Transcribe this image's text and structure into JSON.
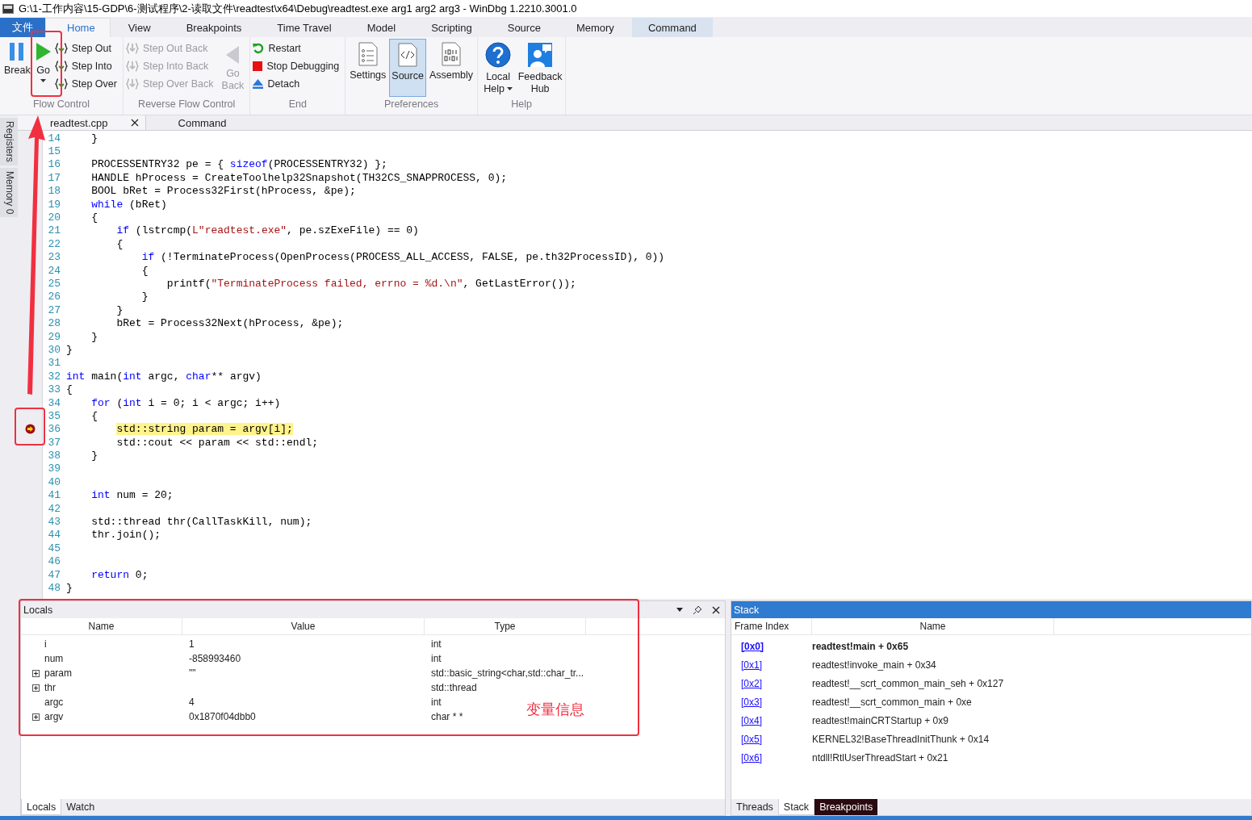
{
  "window": {
    "title": "G:\\1-工作内容\\15-GDP\\6-测试程序\\2-读取文件\\readtest\\x64\\Debug\\readtest.exe arg1 arg2 arg3 - WinDbg 1.2210.3001.0"
  },
  "file_tab": "文件",
  "ribbon_tabs": [
    {
      "label": "Home",
      "selected": true,
      "hovered": false
    },
    {
      "label": "View",
      "selected": false,
      "hovered": false
    },
    {
      "label": "Breakpoints",
      "selected": false,
      "hovered": false
    },
    {
      "label": "Time Travel",
      "selected": false,
      "hovered": false
    },
    {
      "label": "Model",
      "selected": false,
      "hovered": false
    },
    {
      "label": "Scripting",
      "selected": false,
      "hovered": false
    },
    {
      "label": "Source",
      "selected": false,
      "hovered": false
    },
    {
      "label": "Memory",
      "selected": false,
      "hovered": false
    },
    {
      "label": "Command",
      "selected": false,
      "hovered": true
    }
  ],
  "ribbon_groups": [
    {
      "label": "Flow Control",
      "items": [
        {
          "kind": "large",
          "label": "Break",
          "disabled": false,
          "selected": false,
          "dropdown": false
        },
        {
          "kind": "large",
          "label": "Go",
          "disabled": false,
          "selected": false,
          "dropdown": true
        },
        {
          "kind": "column",
          "buttons": [
            {
              "label": "Step Out",
              "disabled": false
            },
            {
              "label": "Step Into",
              "disabled": false
            },
            {
              "label": "Step Over",
              "disabled": false
            }
          ]
        }
      ]
    },
    {
      "label": "Reverse Flow Control",
      "items": [
        {
          "kind": "column",
          "buttons": [
            {
              "label": "Step Out Back",
              "disabled": true
            },
            {
              "label": "Step Into Back",
              "disabled": true
            },
            {
              "label": "Step Over Back",
              "disabled": true
            }
          ]
        },
        {
          "kind": "large",
          "label": "Go Back",
          "disabled": true,
          "selected": false,
          "dropdown": false
        }
      ]
    },
    {
      "label": "End",
      "items": [
        {
          "kind": "column",
          "buttons": [
            {
              "label": "Restart",
              "disabled": false
            },
            {
              "label": "Stop Debugging",
              "disabled": false
            },
            {
              "label": "Detach",
              "disabled": false
            }
          ]
        }
      ]
    },
    {
      "label": "Preferences",
      "items": [
        {
          "kind": "large",
          "label": "Settings",
          "disabled": false,
          "selected": false,
          "dropdown": false
        },
        {
          "kind": "large",
          "label": "Source",
          "disabled": false,
          "selected": true,
          "dropdown": false
        },
        {
          "kind": "large",
          "label": "Assembly",
          "disabled": false,
          "selected": false,
          "dropdown": false
        }
      ]
    },
    {
      "label": "Help",
      "items": [
        {
          "kind": "large",
          "label": "Local Help",
          "disabled": false,
          "selected": false,
          "dropdown": true
        },
        {
          "kind": "large",
          "label": "Feedback Hub",
          "disabled": false,
          "selected": false,
          "dropdown": false
        }
      ]
    }
  ],
  "side_tabs": [
    "Registers",
    "Memory 0"
  ],
  "doc_tabs": [
    {
      "label": "readtest.cpp",
      "selected": true,
      "closable": true
    },
    {
      "label": "Command",
      "selected": false,
      "closable": false
    }
  ],
  "code": [
    {
      "num": "14",
      "current": false,
      "segs": [
        {
          "kind": "plain",
          "t": "    }"
        }
      ]
    },
    {
      "num": "15",
      "current": false
    },
    {
      "num": "16",
      "current": false,
      "segs": [
        {
          "kind": "plain",
          "t": "    PROCESSENTRY32 pe = { "
        },
        {
          "kind": "keyword",
          "t": "sizeof"
        },
        {
          "kind": "plain",
          "t": "(PROCESSENTRY32) };"
        }
      ]
    },
    {
      "num": "17",
      "current": false,
      "segs": [
        {
          "kind": "plain",
          "t": "    HANDLE hProcess = CreateToolhelp32Snapshot(TH32CS_SNAPPROCESS, 0);"
        }
      ]
    },
    {
      "num": "18",
      "current": false,
      "segs": [
        {
          "kind": "plain",
          "t": "    BOOL bRet = Process32First(hProcess, &pe);"
        }
      ]
    },
    {
      "num": "19",
      "current": false,
      "segs": [
        {
          "kind": "keyword",
          "t": "    while"
        },
        {
          "kind": "plain",
          "t": " (bRet)"
        }
      ]
    },
    {
      "num": "20",
      "current": false,
      "segs": [
        {
          "kind": "plain",
          "t": "    {"
        }
      ]
    },
    {
      "num": "21",
      "current": false,
      "segs": [
        {
          "kind": "keyword",
          "t": "        if"
        },
        {
          "kind": "plain",
          "t": " (lstrcmp("
        },
        {
          "kind": "string",
          "t": "L\"readtest.exe\""
        },
        {
          "kind": "plain",
          "t": ", pe.szExeFile) == 0)"
        }
      ]
    },
    {
      "num": "22",
      "current": false,
      "segs": [
        {
          "kind": "plain",
          "t": "        {"
        }
      ]
    },
    {
      "num": "23",
      "current": false,
      "segs": [
        {
          "kind": "keyword",
          "t": "            if"
        },
        {
          "kind": "plain",
          "t": " (!TerminateProcess(OpenProcess(PROCESS_ALL_ACCESS, FALSE, pe.th32ProcessID), 0))"
        }
      ]
    },
    {
      "num": "24",
      "current": false,
      "segs": [
        {
          "kind": "plain",
          "t": "            {"
        }
      ]
    },
    {
      "num": "25",
      "current": false,
      "segs": [
        {
          "kind": "plain",
          "t": "                printf("
        },
        {
          "kind": "string",
          "t": "\"TerminateProcess failed, errno = %d.\\n\""
        },
        {
          "kind": "plain",
          "t": ", GetLastError());"
        }
      ]
    },
    {
      "num": "26",
      "current": false,
      "segs": [
        {
          "kind": "plain",
          "t": "            }"
        }
      ]
    },
    {
      "num": "27",
      "current": false,
      "segs": [
        {
          "kind": "plain",
          "t": "        }"
        }
      ]
    },
    {
      "num": "28",
      "current": false,
      "segs": [
        {
          "kind": "plain",
          "t": "        bRet = Process32Next(hProcess, &pe);"
        }
      ]
    },
    {
      "num": "29",
      "current": false,
      "segs": [
        {
          "kind": "plain",
          "t": "    }"
        }
      ]
    },
    {
      "num": "30",
      "current": false,
      "segs": [
        {
          "kind": "plain",
          "t": "}"
        }
      ]
    },
    {
      "num": "31",
      "current": false
    },
    {
      "num": "32",
      "current": false,
      "segs": [
        {
          "kind": "keyword",
          "t": "int"
        },
        {
          "kind": "plain",
          "t": " main("
        },
        {
          "kind": "keyword",
          "t": "int"
        },
        {
          "kind": "plain",
          "t": " argc, "
        },
        {
          "kind": "keyword",
          "t": "char"
        },
        {
          "kind": "plain",
          "t": "** argv)"
        }
      ]
    },
    {
      "num": "33",
      "current": false,
      "segs": [
        {
          "kind": "plain",
          "t": "{"
        }
      ]
    },
    {
      "num": "34",
      "current": false,
      "segs": [
        {
          "kind": "keyword",
          "t": "    for"
        },
        {
          "kind": "plain",
          "t": " ("
        },
        {
          "kind": "keyword",
          "t": "int"
        },
        {
          "kind": "plain",
          "t": " i = 0; i < argc; i++)"
        }
      ]
    },
    {
      "num": "35",
      "current": false,
      "segs": [
        {
          "kind": "plain",
          "t": "    {"
        }
      ]
    },
    {
      "num": "36",
      "current": true,
      "segs": [
        {
          "kind": "plain",
          "t": "        std::string param = argv[i];"
        }
      ]
    },
    {
      "num": "37",
      "current": false,
      "segs": [
        {
          "kind": "plain",
          "t": "        std::cout << param << std::endl;"
        }
      ]
    },
    {
      "num": "38",
      "current": false,
      "segs": [
        {
          "kind": "plain",
          "t": "    }"
        }
      ]
    },
    {
      "num": "39",
      "current": false
    },
    {
      "num": "40",
      "current": false
    },
    {
      "num": "41",
      "current": false,
      "segs": [
        {
          "kind": "keyword",
          "t": "    int"
        },
        {
          "kind": "plain",
          "t": " num = 20;"
        }
      ]
    },
    {
      "num": "42",
      "current": false
    },
    {
      "num": "43",
      "current": false,
      "segs": [
        {
          "kind": "plain",
          "t": "    std::thread thr(CallTaskKill, num);"
        }
      ]
    },
    {
      "num": "44",
      "current": false,
      "segs": [
        {
          "kind": "plain",
          "t": "    thr.join();"
        }
      ]
    },
    {
      "num": "45",
      "current": false
    },
    {
      "num": "46",
      "current": false
    },
    {
      "num": "47",
      "current": false,
      "segs": [
        {
          "kind": "keyword",
          "t": "    return"
        },
        {
          "kind": "plain",
          "t": " 0;"
        }
      ]
    },
    {
      "num": "48",
      "current": false,
      "segs": [
        {
          "kind": "plain",
          "t": "}"
        }
      ]
    }
  ],
  "locals": {
    "title": "Locals",
    "columns": [
      "Name",
      "Value",
      "Type"
    ],
    "rows": [
      {
        "name": "i",
        "value": "1",
        "type": "int",
        "expandable": false
      },
      {
        "name": "num",
        "value": "-858993460",
        "type": "int",
        "expandable": false
      },
      {
        "name": "param",
        "value": "\"\"",
        "type": "std::basic_string<char,std::char_tr...",
        "expandable": true
      },
      {
        "name": "thr",
        "value": "",
        "type": "std::thread",
        "expandable": true
      },
      {
        "name": "argc",
        "value": "4",
        "type": "int",
        "expandable": false
      },
      {
        "name": "argv",
        "value": "0x1870f04dbb0",
        "type": "char * *",
        "expandable": true
      }
    ],
    "tabs": [
      {
        "label": "Locals",
        "selected": true
      },
      {
        "label": "Watch",
        "selected": false
      }
    ]
  },
  "stack": {
    "title": "Stack",
    "columns": [
      "Frame Index",
      "Name"
    ],
    "rows": [
      {
        "index": "[0x0]",
        "name": "readtest!main + 0x65",
        "current": true
      },
      {
        "index": "[0x1]",
        "name": "readtest!invoke_main + 0x34",
        "current": false
      },
      {
        "index": "[0x2]",
        "name": "readtest!__scrt_common_main_seh + 0x127",
        "current": false
      },
      {
        "index": "[0x3]",
        "name": "readtest!__scrt_common_main + 0xe",
        "current": false
      },
      {
        "index": "[0x4]",
        "name": "readtest!mainCRTStartup + 0x9",
        "current": false
      },
      {
        "index": "[0x5]",
        "name": "KERNEL32!BaseThreadInitThunk + 0x14",
        "current": false
      },
      {
        "index": "[0x6]",
        "name": "ntdll!RtlUserThreadStart + 0x21",
        "current": false
      }
    ],
    "tabs": [
      {
        "label": "Threads",
        "selected": false,
        "hovered": false
      },
      {
        "label": "Stack",
        "selected": true,
        "hovered": false
      },
      {
        "label": "Breakpoints",
        "selected": false,
        "hovered": true
      }
    ]
  },
  "annotation": {
    "label": "变量信息"
  }
}
